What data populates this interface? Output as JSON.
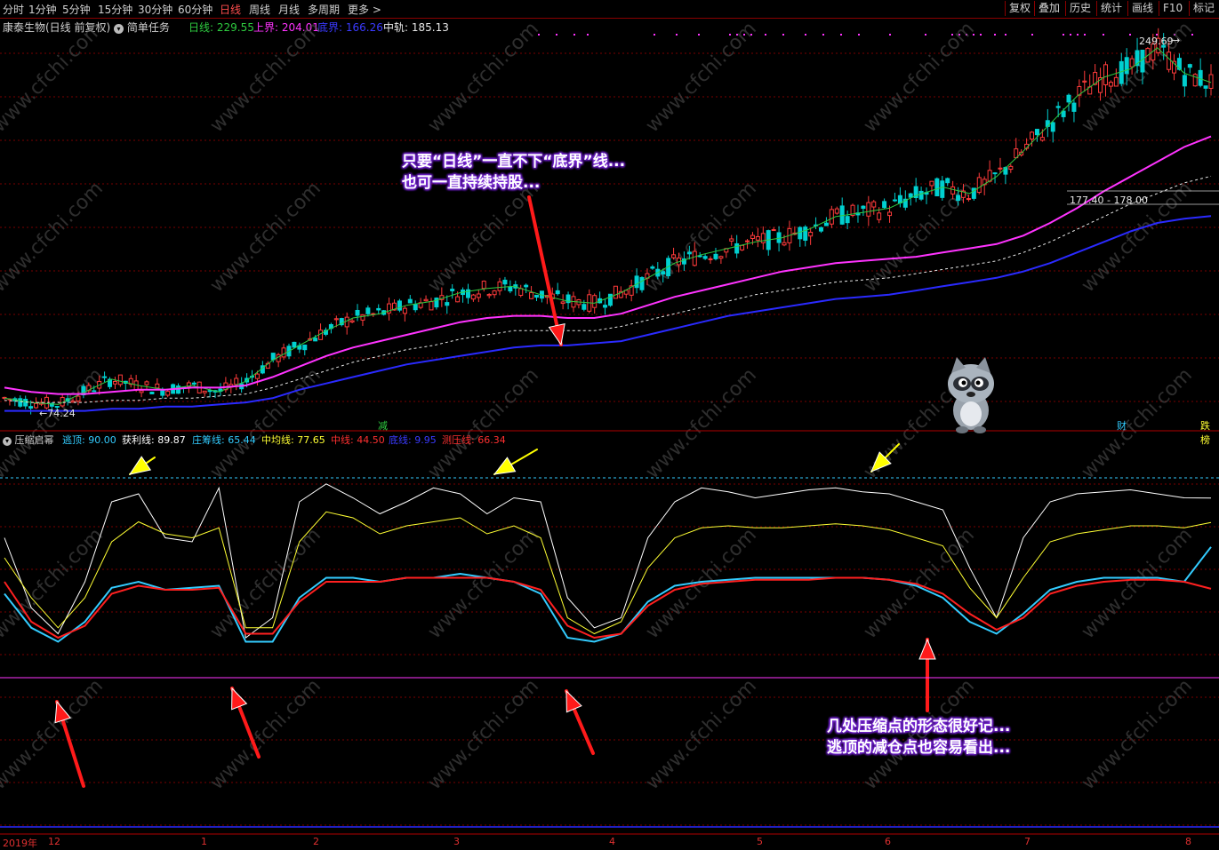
{
  "toolbar": {
    "periods": [
      "分时",
      "1分钟",
      "5分钟",
      "15分钟",
      "30分钟",
      "60分钟",
      "日线",
      "周线",
      "月线",
      "多周期",
      "更多 >"
    ],
    "active": "日线",
    "right": [
      "复权",
      "叠加",
      "历史",
      "统计",
      "画线",
      "F10",
      "标记"
    ]
  },
  "header": {
    "stock": "康泰生物(日线 前复权)",
    "task": "简单任务",
    "riline": "日线: 229.55",
    "shangjie": "上界: 204.01",
    "dijie": "底界: 166.26",
    "zhonggui": "中轨: 185.13"
  },
  "price": {
    "high_label": "249.69",
    "low_label": "←74.24",
    "range_label": "177.40 - 178.00",
    "markers": [
      "减",
      "财",
      "跌榜"
    ]
  },
  "indicator": {
    "name": "压缩启幂",
    "taoding": "逃顶: 90.00",
    "huoli": "获利线: 89.87",
    "zhuangchou": "庄筹线: 65.44",
    "zhongjun": "中均线: 77.65",
    "zhongxian": "中线: 44.50",
    "dixian": "底线: 9.95",
    "ceyaxian": "测压线: 66.34"
  },
  "annotations": {
    "top1": "只要“日线”一直不下“底界”线...",
    "top2": "也可一直持续持股...",
    "bottom1": "几处压缩点的形态很好记...",
    "bottom2": "逃顶的减仓点也容易看出..."
  },
  "x_axis": {
    "labels": [
      "2019年",
      "12",
      "1",
      "2",
      "3",
      "4",
      "5",
      "6",
      "7",
      "8"
    ]
  },
  "watermark": "www.cfchi.com",
  "colors": {
    "up": "#ff3b3b",
    "down": "#00d0d0",
    "magenta": "#ff33ff",
    "blue": "#2a2aff",
    "white": "#ffffff",
    "yellow": "#ffff33",
    "cyan": "#33ccff",
    "red": "#ff2020",
    "grid": "#7a0000",
    "ann_glow": "#7a2bd6"
  },
  "chart_data": {
    "type": "candlestick",
    "price_range": [
      74.24,
      249.69
    ],
    "series": [
      {
        "name": "日线",
        "values": [
          80,
          78,
          77,
          83,
          89,
          86,
          84,
          86,
          83,
          88,
          98,
          105,
          112,
          118,
          120,
          124,
          126,
          130,
          132,
          133,
          129,
          126,
          125,
          130,
          137,
          144,
          148,
          151,
          154,
          156,
          160,
          166,
          168,
          170,
          176,
          180,
          177,
          185,
          197,
          210,
          223,
          232,
          236,
          246,
          234,
          229.55
        ]
      },
      {
        "name": "上界",
        "values": [
          85,
          83,
          82,
          82,
          83,
          84,
          84,
          85,
          85,
          86,
          90,
          95,
          100,
          104,
          107,
          110,
          113,
          116,
          118,
          119,
          119,
          118,
          118,
          120,
          124,
          128,
          131,
          134,
          137,
          140,
          142,
          144,
          145,
          146,
          147,
          149,
          151,
          153,
          157,
          163,
          170,
          178,
          185,
          192,
          199,
          204.01
        ]
      },
      {
        "name": "中轨",
        "values": [
          79,
          78,
          78,
          78,
          79,
          79,
          80,
          80,
          81,
          82,
          85,
          89,
          93,
          97,
          100,
          103,
          105,
          108,
          110,
          112,
          112,
          112,
          112,
          114,
          117,
          120,
          123,
          126,
          129,
          131,
          133,
          135,
          136,
          137,
          139,
          141,
          143,
          145,
          149,
          154,
          160,
          166,
          172,
          177,
          182,
          185.13
        ]
      },
      {
        "name": "底界",
        "values": [
          74,
          74,
          74,
          74,
          75,
          75,
          76,
          76,
          77,
          78,
          80,
          84,
          87,
          90,
          93,
          96,
          98,
          100,
          102,
          104,
          105,
          105,
          106,
          107,
          110,
          113,
          116,
          119,
          121,
          123,
          125,
          127,
          128,
          129,
          131,
          133,
          135,
          137,
          140,
          144,
          149,
          154,
          159,
          163,
          165,
          166.26
        ]
      }
    ],
    "indicator": {
      "ylim": [
        0,
        100
      ],
      "series": [
        {
          "name": "逃顶",
          "values": [
            90,
            90
          ]
        },
        {
          "name": "获利线",
          "values": [
            70,
            35,
            22,
            48,
            88,
            92,
            70,
            68,
            95,
            20,
            30,
            88,
            97,
            90,
            82,
            88,
            95,
            92,
            82,
            90,
            88,
            40,
            25,
            30,
            70,
            88,
            95,
            93,
            90,
            92,
            94,
            95,
            93,
            92,
            88,
            84,
            55,
            30,
            70,
            88,
            92,
            93,
            94,
            92,
            90,
            89.87
          ]
        },
        {
          "name": "中均线",
          "values": [
            60,
            40,
            25,
            40,
            68,
            78,
            72,
            70,
            75,
            25,
            25,
            68,
            83,
            80,
            72,
            76,
            78,
            80,
            72,
            76,
            70,
            30,
            22,
            28,
            55,
            70,
            75,
            76,
            75,
            75,
            76,
            77,
            76,
            74,
            70,
            66,
            45,
            30,
            50,
            68,
            72,
            74,
            76,
            76,
            75,
            77.65
          ]
        },
        {
          "name": "庄筹线",
          "values": [
            42,
            25,
            18,
            28,
            45,
            48,
            44,
            45,
            46,
            18,
            18,
            40,
            50,
            50,
            48,
            50,
            50,
            52,
            50,
            48,
            42,
            20,
            18,
            22,
            38,
            46,
            48,
            49,
            50,
            50,
            50,
            50,
            50,
            49,
            46,
            40,
            28,
            22,
            32,
            44,
            48,
            50,
            50,
            50,
            48,
            65.44
          ]
        },
        {
          "name": "中线",
          "values": [
            48,
            28,
            20,
            26,
            42,
            46,
            44,
            44,
            45,
            22,
            22,
            38,
            48,
            48,
            48,
            50,
            50,
            50,
            50,
            48,
            44,
            26,
            20,
            22,
            36,
            44,
            47,
            48,
            49,
            49,
            49,
            50,
            50,
            49,
            47,
            42,
            32,
            24,
            30,
            42,
            46,
            48,
            49,
            49,
            48,
            44.5
          ]
        },
        {
          "name": "底线",
          "values": [
            9.95,
            9.95
          ]
        }
      ]
    }
  }
}
